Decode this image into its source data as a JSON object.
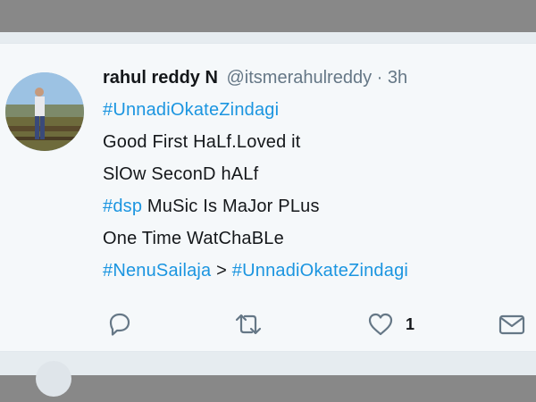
{
  "tweet": {
    "display_name": "rahul reddy N",
    "handle": "@itsmerahulreddy",
    "separator": "·",
    "time": "3h",
    "line1_hashtag": "#UnnadiOkateZindagi",
    "line2": "Good First HaLf.Loved it",
    "line3": "SlOw SeconD hALf",
    "line4_hashtag": "#dsp",
    "line4_text": " MuSic Is MaJor PLus",
    "line5": "One Time WatChaBLe",
    "line6_hashtag_a": "#NenuSailaja",
    "line6_separator": " > ",
    "line6_hashtag_b": "#UnnadiOkateZindagi"
  },
  "actions": {
    "reply_icon": "reply-icon",
    "retweet_icon": "retweet-icon",
    "like_icon": "heart-icon",
    "like_count": "1",
    "message_icon": "envelope-icon"
  },
  "colors": {
    "hashtag": "#1b95e0",
    "text": "#14171a",
    "secondary": "#657786",
    "background": "#f5f8fa"
  }
}
